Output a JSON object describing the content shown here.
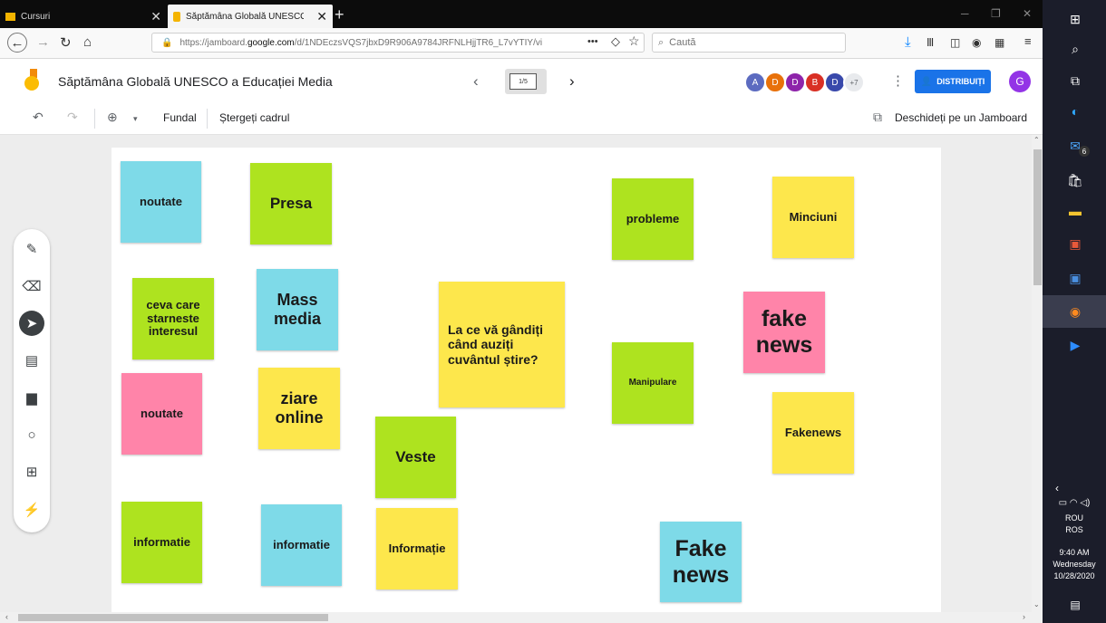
{
  "browser": {
    "tabs": [
      {
        "title": "Cursuri"
      },
      {
        "title": "Săptămâna Globală UNESCO a"
      }
    ],
    "url_prefix": "https://jamboard.",
    "url_domain": "google.com",
    "url_rest": "/d/1NDEczsVQS7jbxD9R906A9784JRFNLHjjTR6_L7vYTIY/vi",
    "url_more": "•••",
    "search_placeholder": "Caută"
  },
  "app": {
    "title": "Săptămâna Globală UNESCO a Educației Media",
    "frame_indicator": "1/5",
    "prev": "‹",
    "next": "›",
    "collaborators": [
      {
        "initial": "A",
        "color": "#5c6bc0"
      },
      {
        "initial": "D",
        "color": "#e8710a"
      },
      {
        "initial": "D",
        "color": "#8e24aa"
      },
      {
        "initial": "B",
        "color": "#d93025"
      },
      {
        "initial": "D",
        "color": "#3949ab"
      }
    ],
    "more_collaborators": "+7",
    "share_label": "DISTRIBUIȚI",
    "user_initial": "G"
  },
  "toolbar": {
    "background_label": "Fundal",
    "clear_label": "Ștergeți cadrul",
    "open_label": "Deschideți pe un Jamboard"
  },
  "notes": [
    {
      "text": "noutate",
      "color": "blue"
    },
    {
      "text": "Presa",
      "color": "green"
    },
    {
      "text": "probleme",
      "color": "green"
    },
    {
      "text": "Minciuni",
      "color": "yellow"
    },
    {
      "text": "ceva care starneste interesul",
      "color": "green"
    },
    {
      "text": "Mass media",
      "color": "blue"
    },
    {
      "text": "La ce vă gândiți când auziți cuvântul știre?",
      "color": "yellow"
    },
    {
      "text": "fake news",
      "color": "pink"
    },
    {
      "text": "noutate",
      "color": "pink"
    },
    {
      "text": "ziare online",
      "color": "yellow"
    },
    {
      "text": "Manipulare",
      "color": "green"
    },
    {
      "text": "Veste",
      "color": "green"
    },
    {
      "text": "Fakenews",
      "color": "yellow"
    },
    {
      "text": "informatie",
      "color": "green"
    },
    {
      "text": "informatie",
      "color": "blue"
    },
    {
      "text": "Informație",
      "color": "yellow"
    },
    {
      "text": "Fake news",
      "color": "blue"
    }
  ],
  "taskbar": {
    "mail_badge": "6",
    "language": "ROU",
    "language2": "ROS",
    "time": "9:40 AM",
    "day": "Wednesday",
    "date": "10/28/2020"
  },
  "colors": {
    "blue": "#7edae8",
    "green": "#aee31f",
    "yellow": "#fde74c",
    "pink": "#ff84a9",
    "accent": "#1a73e8"
  }
}
